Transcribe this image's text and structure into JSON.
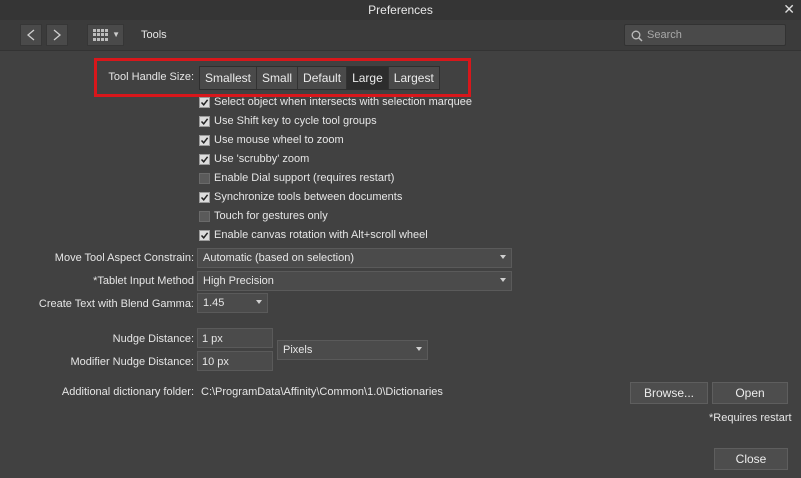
{
  "window": {
    "title": "Preferences",
    "close_glyph": "✕"
  },
  "toolbar": {
    "back_icon": "chevron-left-icon",
    "forward_icon": "chevron-right-icon",
    "section_label": "Tools",
    "search_placeholder": "Search"
  },
  "tool_handle": {
    "label": "Tool Handle Size:",
    "options": [
      "Smallest",
      "Small",
      "Default",
      "Large",
      "Largest"
    ],
    "selected": "Large"
  },
  "checkboxes": [
    {
      "label": "Select object when intersects with selection marquee",
      "checked": true
    },
    {
      "label": "Use Shift key to cycle tool groups",
      "checked": true
    },
    {
      "label": "Use mouse wheel to zoom",
      "checked": true
    },
    {
      "label": "Use 'scrubby' zoom",
      "checked": true
    },
    {
      "label": "Enable Dial support (requires restart)",
      "checked": false
    },
    {
      "label": "Synchronize tools between documents",
      "checked": true
    },
    {
      "label": "Touch for gestures only",
      "checked": false
    },
    {
      "label": "Enable canvas rotation with Alt+scroll wheel",
      "checked": true
    }
  ],
  "move_tool": {
    "label": "Move Tool Aspect Constrain:",
    "value": "Automatic (based on selection)"
  },
  "tablet": {
    "label": "*Tablet Input Method",
    "value": "High Precision"
  },
  "blend_gamma": {
    "label": "Create Text with Blend Gamma:",
    "value": "1.45"
  },
  "nudge": {
    "label": "Nudge Distance:",
    "value": "1 px",
    "modifier_label": "Modifier Nudge Distance:",
    "modifier_value": "10 px",
    "unit": "Pixels"
  },
  "dictionary": {
    "label": "Additional dictionary folder:",
    "path": "C:\\ProgramData\\Affinity\\Common\\1.0\\Dictionaries",
    "browse_label": "Browse...",
    "open_label": "Open"
  },
  "restart_note": "*Requires restart",
  "close_label": "Close"
}
